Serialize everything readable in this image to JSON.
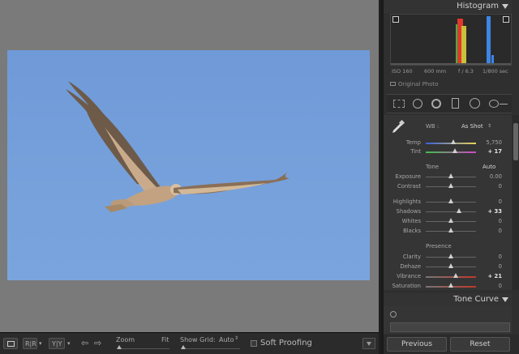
{
  "histogram": {
    "title": "Histogram",
    "iso": "ISO 160",
    "focal": "600 mm",
    "aperture": "f / 6.3",
    "shutter": "1/800 sec",
    "original_photo": "Original Photo"
  },
  "basic": {
    "wb_label": "WB :",
    "wb_value": "As Shot",
    "tone_label": "Tone",
    "auto_label": "Auto",
    "presence_label": "Presence",
    "sliders": [
      {
        "label": "Temp",
        "value": "5,750",
        "pos": 0.55
      },
      {
        "label": "Tint",
        "value": "+ 17",
        "pos": 0.58
      },
      {
        "label": "Exposure",
        "value": "0.00",
        "pos": 0.5
      },
      {
        "label": "Contrast",
        "value": "0",
        "pos": 0.5
      },
      {
        "label": "Highlights",
        "value": "0",
        "pos": 0.5
      },
      {
        "label": "Shadows",
        "value": "+ 33",
        "pos": 0.66
      },
      {
        "label": "Whites",
        "value": "0",
        "pos": 0.5
      },
      {
        "label": "Blacks",
        "value": "0",
        "pos": 0.5
      },
      {
        "label": "Clarity",
        "value": "0",
        "pos": 0.5
      },
      {
        "label": "Dehaze",
        "value": "0",
        "pos": 0.5
      },
      {
        "label": "Vibrance",
        "value": "+ 21",
        "pos": 0.6
      },
      {
        "label": "Saturation",
        "value": "0",
        "pos": 0.5
      }
    ]
  },
  "tone_curve": {
    "title": "Tone Curve"
  },
  "buttons": {
    "previous": "Previous",
    "reset": "Reset"
  },
  "toolbar": {
    "zoom_label": "Zoom",
    "fit_label": "Fit",
    "grid_label": "Show Grid:",
    "grid_value": "Auto",
    "soft_proofing": "Soft Proofing",
    "ry1": "R|R",
    "ry2": "Y|Y"
  },
  "colors": {
    "panel_bg": "#353535",
    "sky": "#74a0db",
    "accent_hist_red": "#e0392b",
    "accent_hist_green": "#3db34a",
    "accent_hist_blue": "#3d86e6"
  }
}
